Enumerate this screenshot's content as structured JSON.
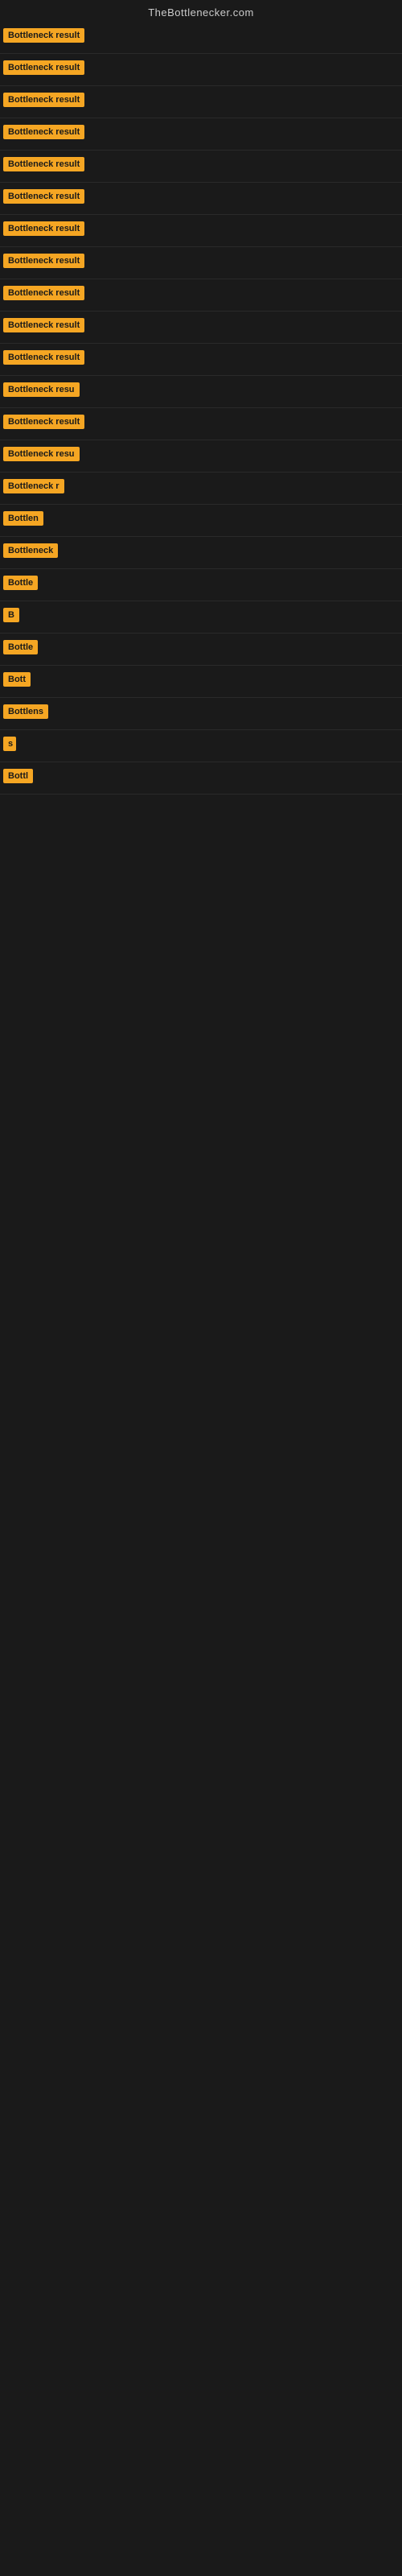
{
  "site": {
    "title": "TheBottlenecker.com"
  },
  "results": [
    {
      "id": 1,
      "label": "Bottleneck result",
      "visible_width": 160
    },
    {
      "id": 2,
      "label": "Bottleneck result",
      "visible_width": 160
    },
    {
      "id": 3,
      "label": "Bottleneck result",
      "visible_width": 160
    },
    {
      "id": 4,
      "label": "Bottleneck result",
      "visible_width": 160
    },
    {
      "id": 5,
      "label": "Bottleneck result",
      "visible_width": 160
    },
    {
      "id": 6,
      "label": "Bottleneck result",
      "visible_width": 160
    },
    {
      "id": 7,
      "label": "Bottleneck result",
      "visible_width": 160
    },
    {
      "id": 8,
      "label": "Bottleneck result",
      "visible_width": 160
    },
    {
      "id": 9,
      "label": "Bottleneck result",
      "visible_width": 160
    },
    {
      "id": 10,
      "label": "Bottleneck result",
      "visible_width": 160
    },
    {
      "id": 11,
      "label": "Bottleneck result",
      "visible_width": 160
    },
    {
      "id": 12,
      "label": "Bottleneck resu",
      "visible_width": 140
    },
    {
      "id": 13,
      "label": "Bottleneck result",
      "visible_width": 160
    },
    {
      "id": 14,
      "label": "Bottleneck resu",
      "visible_width": 135
    },
    {
      "id": 15,
      "label": "Bottleneck r",
      "visible_width": 110
    },
    {
      "id": 16,
      "label": "Bottlen",
      "visible_width": 75
    },
    {
      "id": 17,
      "label": "Bottleneck",
      "visible_width": 90
    },
    {
      "id": 18,
      "label": "Bottle",
      "visible_width": 65
    },
    {
      "id": 19,
      "label": "B",
      "visible_width": 22
    },
    {
      "id": 20,
      "label": "Bottle",
      "visible_width": 65
    },
    {
      "id": 21,
      "label": "Bott",
      "visible_width": 48
    },
    {
      "id": 22,
      "label": "Bottlens",
      "visible_width": 78
    },
    {
      "id": 23,
      "label": "s",
      "visible_width": 16
    },
    {
      "id": 24,
      "label": "Bottl",
      "visible_width": 55
    }
  ]
}
